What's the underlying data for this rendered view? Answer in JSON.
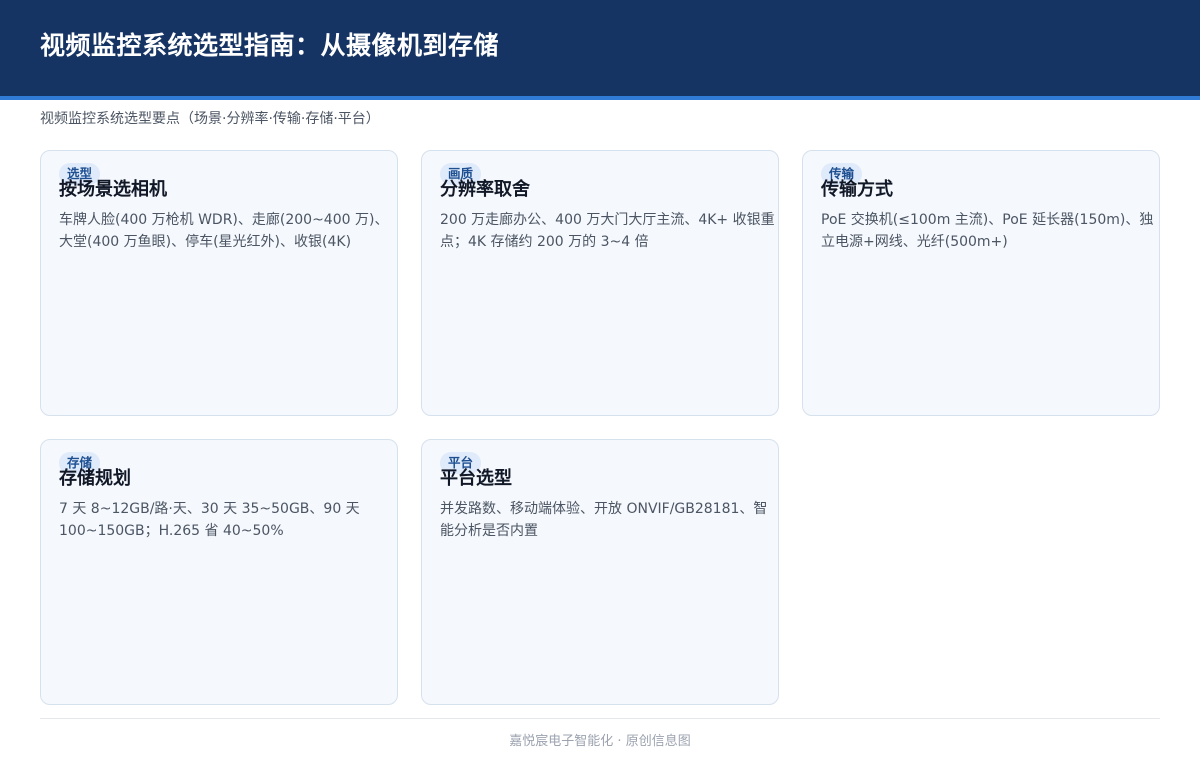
{
  "header": {
    "title": "视频监控系统选型指南：从摄像机到存储",
    "subtitle": "视频监控系统选型要点（场景·分辨率·传输·存储·平台）"
  },
  "cards": [
    {
      "badge": "选型",
      "title": "按场景选相机",
      "body": "车牌人脸(400 万枪机 WDR)、走廊(200~400 万)、大堂(400 万鱼眼)、停车(星光红外)、收银(4K)"
    },
    {
      "badge": "画质",
      "title": "分辨率取舍",
      "body": "200 万走廊办公、400 万大门大厅主流、4K+ 收银重点；4K 存储约 200 万的 3~4 倍"
    },
    {
      "badge": "传输",
      "title": "传输方式",
      "body": "PoE 交换机(≤100m 主流)、PoE 延长器(150m)、独立电源+网线、光纤(500m+)"
    },
    {
      "badge": "存储",
      "title": "存储规划",
      "body": "7 天 8~12GB/路·天、30 天 35~50GB、90 天 100~150GB；H.265 省 40~50%"
    },
    {
      "badge": "平台",
      "title": "平台选型",
      "body": "并发路数、移动端体验、开放 ONVIF/GB28181、智能分析是否内置"
    }
  ],
  "footer": {
    "text": "嘉悦宸电子智能化 · 原创信息图"
  }
}
